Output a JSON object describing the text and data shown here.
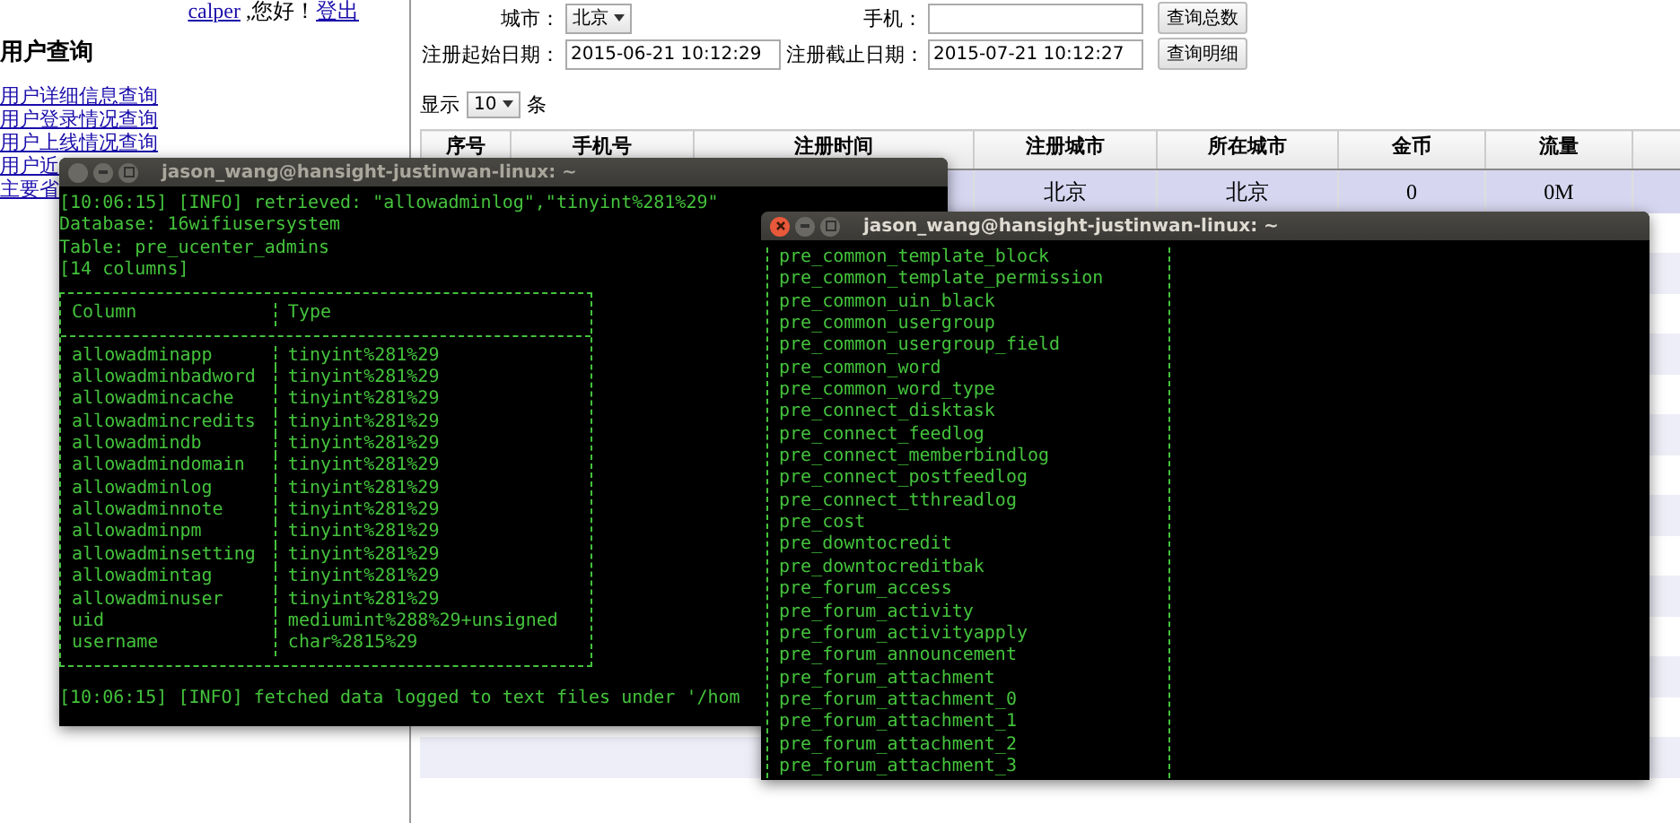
{
  "page": {
    "greeting": {
      "user": "calper",
      "text": " ,您好！",
      "logout": "登出"
    },
    "sidebar": {
      "title": "用户查询",
      "links": [
        "用户详细信息查询",
        "用户登录情况查询",
        "用户上线情况查询",
        "用户近",
        "主要省"
      ]
    },
    "form": {
      "city_label": "城市：",
      "city_value": "北京",
      "phone_label": "手机：",
      "count_button": "查询总数",
      "start_label": "注册起始日期：",
      "start_value": "2015-06-21 10:12:29",
      "end_label": "注册截止日期：",
      "end_value": "2015-07-21 10:12:27",
      "detail_button": "查询明细"
    },
    "page_size": {
      "prefix": "显示",
      "value": "10",
      "suffix": "条"
    },
    "table": {
      "columns": [
        "序号",
        "手机号",
        "注册时间",
        "注册城市",
        "所在城市",
        "金币",
        "流量"
      ],
      "rows": [
        {
          "selected": true,
          "cells": [
            "",
            "",
            "",
            "北京",
            "北京",
            "0",
            "0M"
          ]
        }
      ]
    }
  },
  "terminals": [
    {
      "title": "jason_wang@hansight-justinwan-linux: ~",
      "active": false,
      "lines_before": [
        "[10:06:15] [INFO] retrieved: \"allowadminlog\",\"tinyint%281%29\"",
        "Database: 16wifiusersystem",
        "Table: pre_ucenter_admins",
        "[14 columns]"
      ],
      "table": {
        "columns": [
          "Column",
          "Type"
        ],
        "rows": [
          [
            "allowadminapp",
            "tinyint%281%29"
          ],
          [
            "allowadminbadword",
            "tinyint%281%29"
          ],
          [
            "allowadmincache",
            "tinyint%281%29"
          ],
          [
            "allowadmincredits",
            "tinyint%281%29"
          ],
          [
            "allowadmindb",
            "tinyint%281%29"
          ],
          [
            "allowadmindomain",
            "tinyint%281%29"
          ],
          [
            "allowadminlog",
            "tinyint%281%29"
          ],
          [
            "allowadminnote",
            "tinyint%281%29"
          ],
          [
            "allowadminpm",
            "tinyint%281%29"
          ],
          [
            "allowadminsetting",
            "tinyint%281%29"
          ],
          [
            "allowadmintag",
            "tinyint%281%29"
          ],
          [
            "allowadminuser",
            "tinyint%281%29"
          ],
          [
            "uid",
            "mediumint%288%29+unsigned"
          ],
          [
            "username",
            "char%2815%29"
          ]
        ]
      },
      "lines_after": [
        "[10:06:15] [INFO] fetched data logged to text files under '/hom"
      ]
    },
    {
      "title": "jason_wang@hansight-justinwan-linux: ~",
      "active": true,
      "table": {
        "rows": [
          "pre_common_template_block",
          "pre_common_template_permission",
          "pre_common_uin_black",
          "pre_common_usergroup",
          "pre_common_usergroup_field",
          "pre_common_word",
          "pre_common_word_type",
          "pre_connect_disktask",
          "pre_connect_feedlog",
          "pre_connect_memberbindlog",
          "pre_connect_postfeedlog",
          "pre_connect_tthreadlog",
          "pre_cost",
          "pre_downtocredit",
          "pre_downtocreditbak",
          "pre_forum_access",
          "pre_forum_activity",
          "pre_forum_activityapply",
          "pre_forum_announcement",
          "pre_forum_attachment",
          "pre_forum_attachment_0",
          "pre_forum_attachment_1",
          "pre_forum_attachment_2",
          "pre_forum_attachment_3"
        ]
      }
    }
  ]
}
